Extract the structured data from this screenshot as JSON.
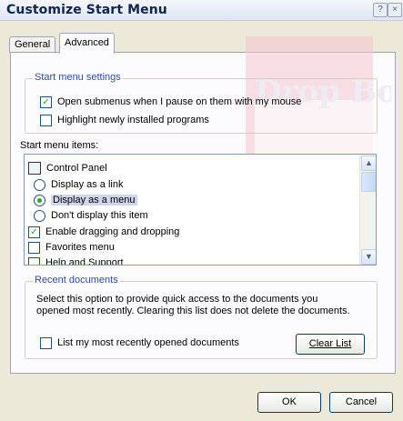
{
  "window": {
    "title": "Customize Start Menu"
  },
  "titlebar_buttons": [
    "?",
    "×"
  ],
  "tabs": [
    {
      "label": "General"
    },
    {
      "label": "Advanced"
    }
  ],
  "start_menu_settings": {
    "title": "Start menu settings",
    "options": [
      {
        "label": "Open submenus when I pause on them with my mouse",
        "checked": true
      },
      {
        "label": "Highlight newly installed programs",
        "checked": false
      }
    ]
  },
  "start_menu_items": {
    "label": "Start menu items:",
    "items": {
      "control_panel": "Control Panel",
      "display_link": "Display as a link",
      "display_menu": "Display as a menu",
      "dont_display": "Don't display this item",
      "drag_drop": "Enable dragging and dropping",
      "favorites": "Favorites menu",
      "help_support": "Help and Support"
    }
  },
  "recent_documents": {
    "title": "Recent documents",
    "description_line1": "Select this option to provide quick access to the documents you",
    "description_line2": "opened most recently.  Clearing this list does not delete the documents.",
    "list_checkbox_label": "List my most recently opened documents",
    "clear_button": "Clear List"
  },
  "buttons": {
    "ok": "OK",
    "cancel": "Cancel"
  },
  "checkmark": "✓",
  "watermark_text": "Drop Boo"
}
